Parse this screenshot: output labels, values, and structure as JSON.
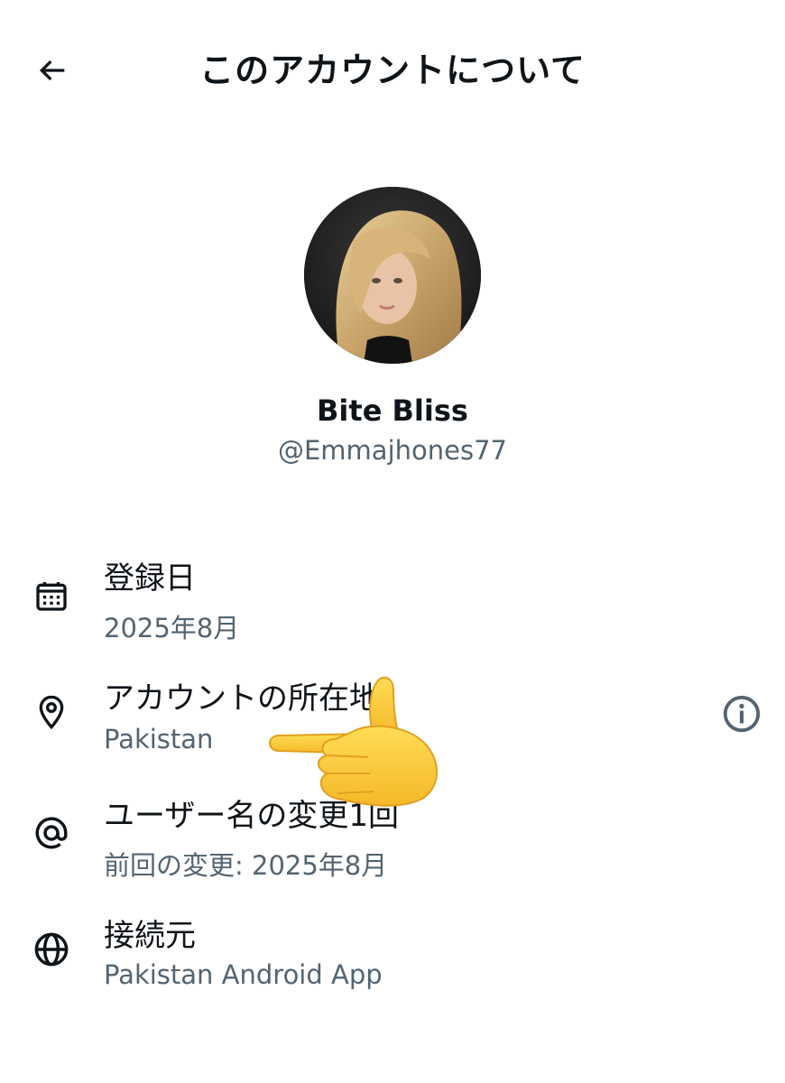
{
  "header": {
    "title": "このアカウントについて",
    "back_icon": "arrow-left-icon"
  },
  "profile": {
    "display_name": "Bite Bliss",
    "handle": "@Emmajhones77"
  },
  "rows": [
    {
      "icon": "calendar-icon",
      "label": "登録日",
      "value": "2025年8月"
    },
    {
      "icon": "location-pin-icon",
      "label": "アカウントの所在地",
      "value": "Pakistan",
      "trailing_icon": "info-icon"
    },
    {
      "icon": "at-sign-icon",
      "label": "ユーザー名の変更1回",
      "value": "前回の変更: 2025年8月"
    },
    {
      "icon": "globe-icon",
      "label": "接続元",
      "value": "Pakistan Android App"
    }
  ],
  "colors": {
    "primary_text": "#0f1419",
    "secondary_text": "#536471",
    "background": "#ffffff"
  }
}
